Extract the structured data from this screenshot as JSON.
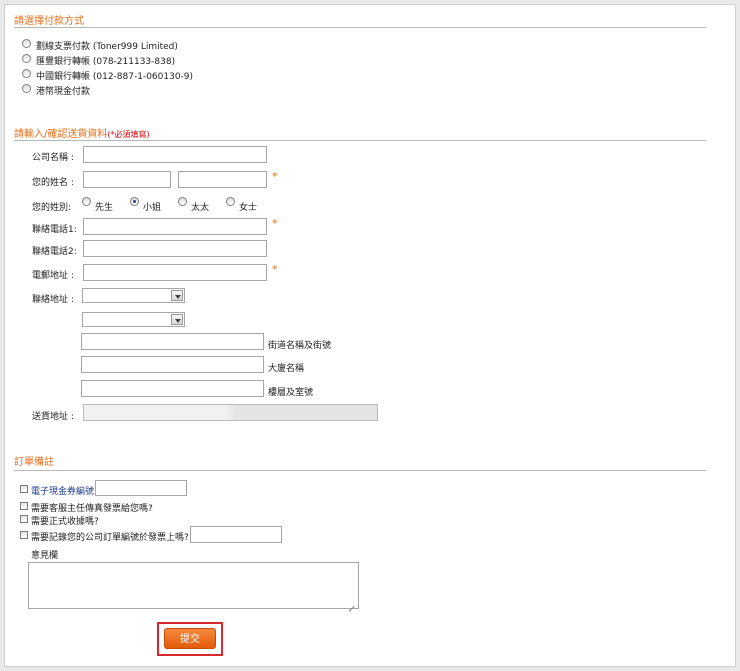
{
  "payment": {
    "title": "請選擇付款方式",
    "options": [
      "劃線支票付款 (Toner999 Limited)",
      "匯豐銀行轉帳 (078-211133-838)",
      "中國銀行轉帳 (012-887-1-060130-9)",
      "港幣現金付款"
    ]
  },
  "delivery": {
    "title": "請輸入/確認送貨資料",
    "required_note": "(*必須填寫)",
    "company_label": "公司名稱 :",
    "name_label": "您的姓名 :",
    "title_label": "您的姓別:",
    "salutations": [
      "先生",
      "小姐",
      "太太",
      "女士"
    ],
    "selected_salutation": "小姐",
    "phone1_label": "聯絡電話1:",
    "phone2_label": "聯絡電話2:",
    "email_label": "電郵地址 :",
    "address_label": "聯絡地址 :",
    "street_label": "街道名稱及街號",
    "building_label": "大廈名稱",
    "floor_label": "樓層及室號",
    "ship_address_label": "送貨地址 :",
    "required_star": "*"
  },
  "notes": {
    "title": "訂單備註",
    "coupon_label": "電子現金券編號",
    "fax_invoice_label": "需要客服主任傳真發票給您嗎?",
    "receipt_label": "需要正式收據嗎?",
    "po_label": "需要記錄您的公司訂單編號於發票上嗎?",
    "comments_label": "意見欄"
  },
  "submit": {
    "label": "提交"
  },
  "colors": {
    "accent": "#e8711c",
    "required": "#e00000",
    "link": "#1c3a8a",
    "button": "#ee6f1e",
    "highlight": "#d9282d"
  }
}
